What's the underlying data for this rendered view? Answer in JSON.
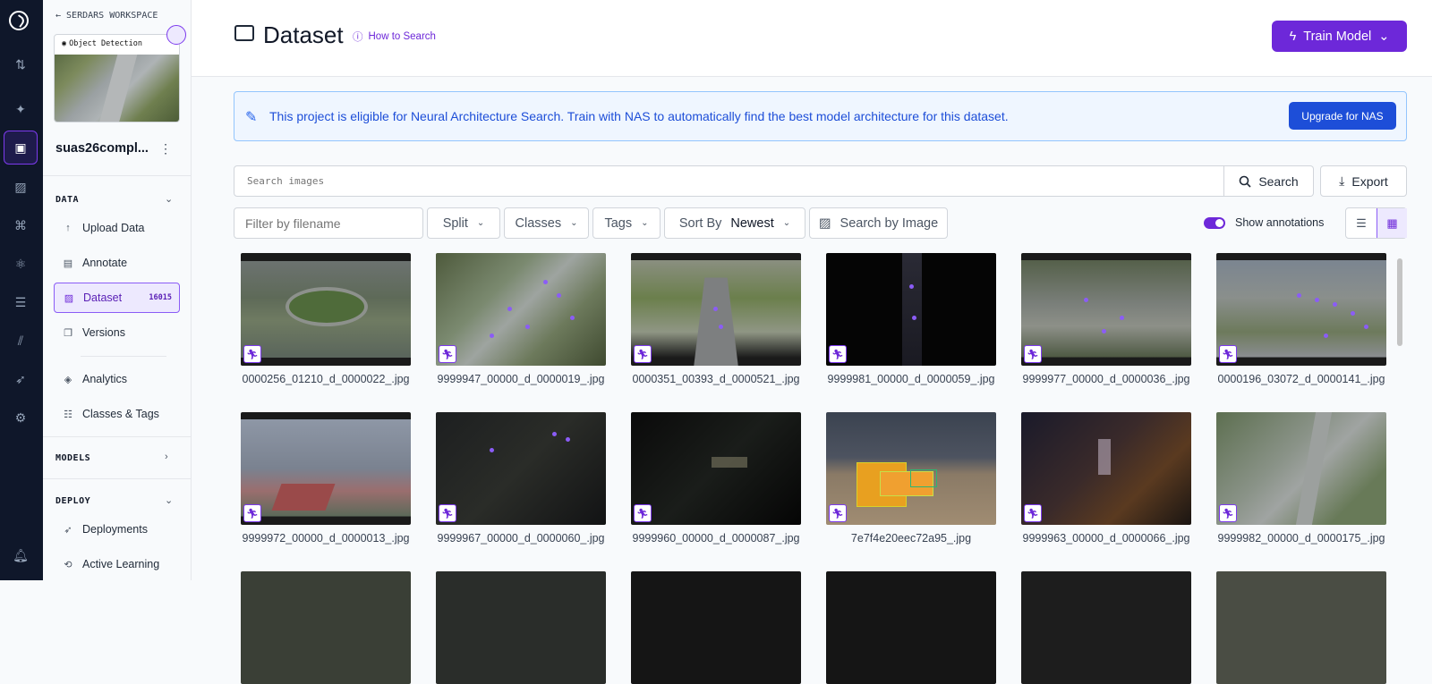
{
  "workspace": {
    "back_label": "SERDARS WORKSPACE"
  },
  "project": {
    "type_label": "Object Detection",
    "name": "suas26compl..."
  },
  "sidebar": {
    "data_section": "DATA",
    "models_section": "MODELS",
    "deploy_section": "DEPLOY",
    "items": [
      {
        "label": "Upload Data",
        "icon": "upload-icon"
      },
      {
        "label": "Annotate",
        "icon": "annotate-icon"
      },
      {
        "label": "Dataset",
        "icon": "dataset-icon",
        "count": "16015",
        "active": true
      },
      {
        "label": "Versions",
        "icon": "versions-icon"
      },
      {
        "label": "Analytics",
        "icon": "analytics-icon"
      },
      {
        "label": "Classes & Tags",
        "icon": "classes-icon"
      },
      {
        "label": "Deployments",
        "icon": "rocket-icon"
      },
      {
        "label": "Active Learning",
        "icon": "loop-icon"
      }
    ]
  },
  "header": {
    "title": "Dataset",
    "how_to_search": "How to Search",
    "train_button": "Train Model"
  },
  "banner": {
    "text": "This project is eligible for Neural Architecture Search. Train with NAS to automatically find the best model architecture for this dataset.",
    "button": "Upgrade for NAS"
  },
  "search": {
    "placeholder": "Search images",
    "button": "Search",
    "export": "Export"
  },
  "filters": {
    "filename_placeholder": "Filter by filename",
    "split": "Split",
    "classes": "Classes",
    "tags": "Tags",
    "sort_label": "Sort By",
    "sort_value": "Newest",
    "search_by_image": "Search by Image",
    "show_annotations": "Show annotations",
    "show_annotations_on": true
  },
  "colors": {
    "accent": "#6d28d9",
    "banner_bg": "#eff6ff",
    "banner_text": "#1d4ed8",
    "rail": "#0f172a"
  },
  "images": [
    {
      "name": "0000256_01210_d_0000022_.jpg",
      "scene": "roundabout"
    },
    {
      "name": "9999947_00000_d_0000019_.jpg",
      "scene": "intersection"
    },
    {
      "name": "0000351_00393_d_0000521_.jpg",
      "scene": "avenue"
    },
    {
      "name": "9999981_00000_d_0000059_.jpg",
      "scene": "dark-street"
    },
    {
      "name": "9999977_00000_d_0000036_.jpg",
      "scene": "wide-road"
    },
    {
      "name": "0000196_03072_d_0000141_.jpg",
      "scene": "parking"
    },
    {
      "name": "9999972_00000_d_0000013_.jpg",
      "scene": "buildings"
    },
    {
      "name": "9999967_00000_d_0000060_.jpg",
      "scene": "night-lot"
    },
    {
      "name": "9999960_00000_d_0000087_.jpg",
      "scene": "night-street"
    },
    {
      "name": "7e7f4e20eec72a95_.jpg",
      "scene": "beach"
    },
    {
      "name": "9999963_00000_d_0000066_.jpg",
      "scene": "night-road"
    },
    {
      "name": "9999982_00000_d_0000175_.jpg",
      "scene": "green-road"
    }
  ]
}
